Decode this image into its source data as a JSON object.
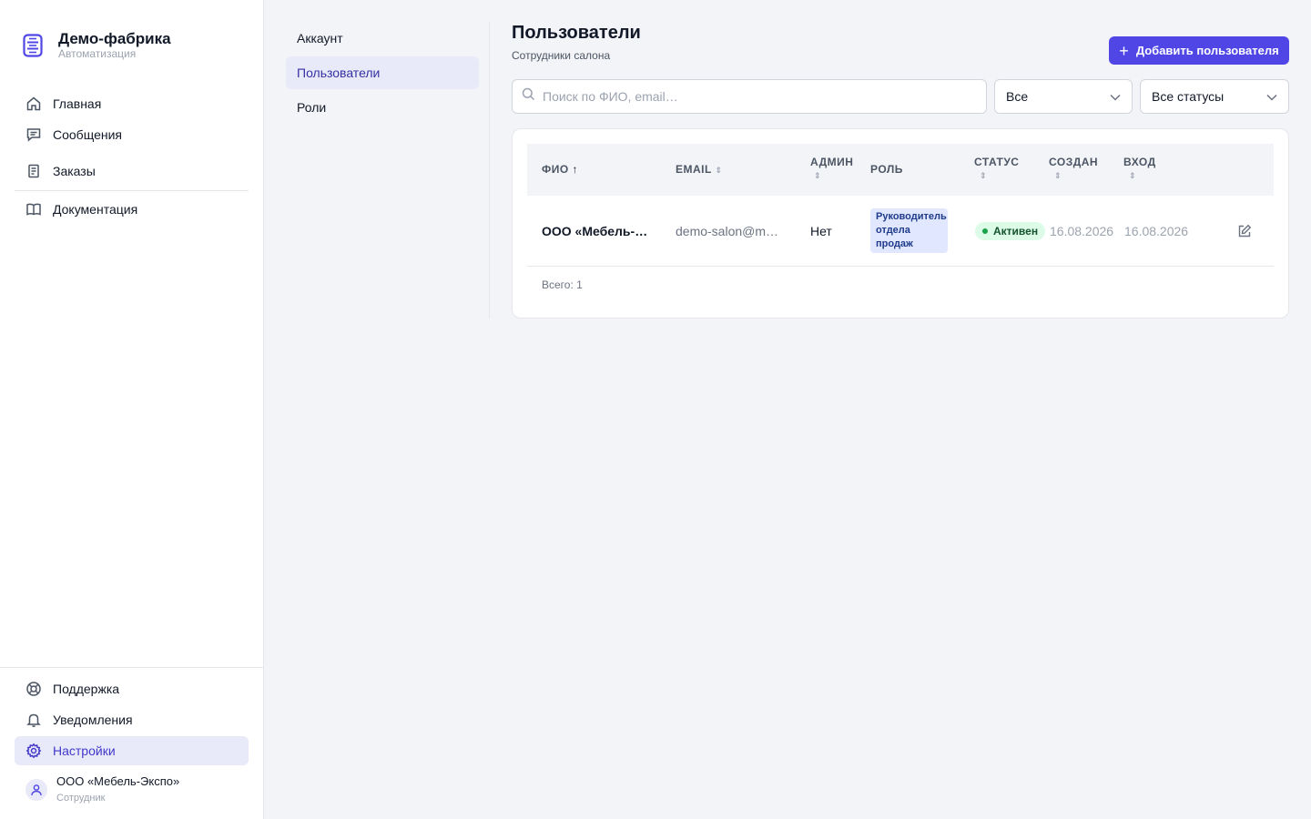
{
  "brand": {
    "title": "Демо-фабрика",
    "subtitle": "Автоматизация"
  },
  "sidebar": {
    "items": [
      {
        "label": "Главная",
        "icon": "home-icon"
      },
      {
        "label": "Сообщения",
        "icon": "message-icon"
      },
      {
        "label": "Заказы",
        "icon": "document-icon"
      },
      {
        "label": "Документация",
        "icon": "book-icon"
      }
    ],
    "bottom_items": [
      {
        "label": "Поддержка",
        "icon": "lifebuoy-icon"
      },
      {
        "label": "Уведомления",
        "icon": "bell-icon"
      },
      {
        "label": "Настройки",
        "icon": "gear-icon",
        "active": true
      }
    ],
    "user": {
      "name": "ООО «Мебель-Экспо»",
      "role": "Сотрудник"
    }
  },
  "subnav": {
    "items": [
      {
        "label": "Аккаунт"
      },
      {
        "label": "Пользователи",
        "active": true
      },
      {
        "label": "Роли"
      }
    ]
  },
  "main": {
    "title": "Пользователи",
    "subtitle": "Сотрудники салона",
    "add_button": "Добавить пользователя",
    "search_placeholder": "Поиск по ФИО, email…",
    "filter_role": "Все",
    "filter_status": "Все статусы"
  },
  "table": {
    "columns": [
      "ФИО",
      "EMAIL",
      "АДМИН",
      "РОЛЬ",
      "СТАТУС",
      "СОЗДАН",
      "ВХОД"
    ],
    "sort_up": "↑",
    "sort_both": "⇕",
    "rows": [
      {
        "name": "ООО «Мебель-…",
        "email": "demo-salon@m…",
        "admin": "Нет",
        "role": "Руководитель отдела продаж",
        "status": "Активен",
        "created": "16.08.2026",
        "login": "16.08.2026"
      }
    ],
    "total": "Всего: 1"
  },
  "colors": {
    "accent": "#4f46e5",
    "active_bg": "#e8eaf9",
    "status_green": "#16a34a"
  }
}
